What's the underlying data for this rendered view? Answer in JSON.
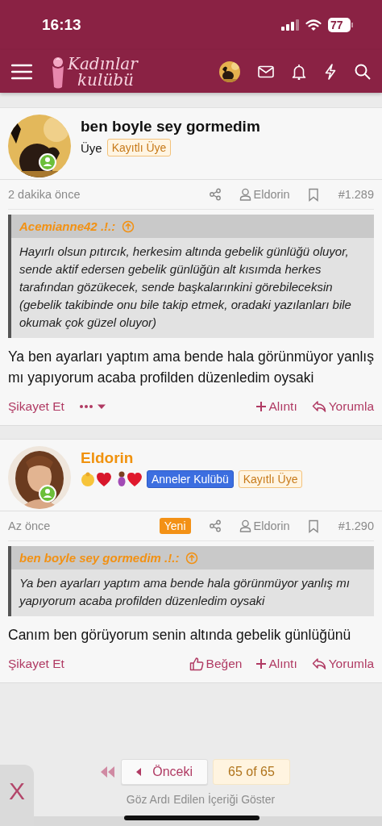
{
  "status_bar": {
    "time": "16:13",
    "battery": "77"
  },
  "header": {
    "logo_lines": [
      "Kadınlar",
      "kulübü"
    ]
  },
  "posts": [
    {
      "author": "ben boyle sey gormedim",
      "color": "#111111",
      "title": "Üye",
      "badges": [
        {
          "label": "Kayıtlı Üye",
          "kind": "rank"
        }
      ],
      "time": "2 dakika önce",
      "user_link": "Eldorin",
      "number": "#1.289",
      "quote": {
        "author": "Acemianne42 .!.:",
        "text": "Hayırlı olsun pıtırcık, herkesim altında gebelik günlüğü oluyor, sende aktif edersen gebelik günlüğün alt kısımda herkes tarafından gözükecek, sende başkalarınkini görebileceksin (gebelik takibinde onu bile takip etmek, oradaki yazılanları bile okumak çok güzel oluyor)"
      },
      "body": "Ya ben ayarları yaptım ama bende hala görünmüyor yanlış mı yapıyorum acaba profilden düzenledim oysaki",
      "report": "Şikayet Et",
      "more_menu": true,
      "actions": [
        {
          "kind": "quote",
          "label": "Alıntı"
        },
        {
          "kind": "reply",
          "label": "Yorumla"
        }
      ]
    },
    {
      "author": "Eldorin",
      "color": "#f0920e",
      "emoji": true,
      "badges": [
        {
          "label": "Anneler Kulübü",
          "kind": "group"
        },
        {
          "label": "Kayıtlı Üye",
          "kind": "rank"
        }
      ],
      "time": "Az önce",
      "new_label": "Yeni",
      "user_link": "Eldorin",
      "number": "#1.290",
      "quote": {
        "author": "ben boyle sey gormedim .!.:",
        "text": "Ya ben ayarları yaptım ama bende hala görünmüyor yanlış mı yapıyorum acaba profilden düzenledim oysaki"
      },
      "body": "Canım ben görüyorum senin altında gebelik günlüğünü",
      "report": "Şikayet Et",
      "actions": [
        {
          "kind": "like",
          "label": "Beğen"
        },
        {
          "kind": "quote",
          "label": "Alıntı"
        },
        {
          "kind": "reply",
          "label": "Yorumla"
        }
      ]
    }
  ],
  "pagination": {
    "previous": "Önceki",
    "current": "65 of 65",
    "ignored_link": "Göz Ardı Edilen İçeriği Göster",
    "close": "X"
  }
}
